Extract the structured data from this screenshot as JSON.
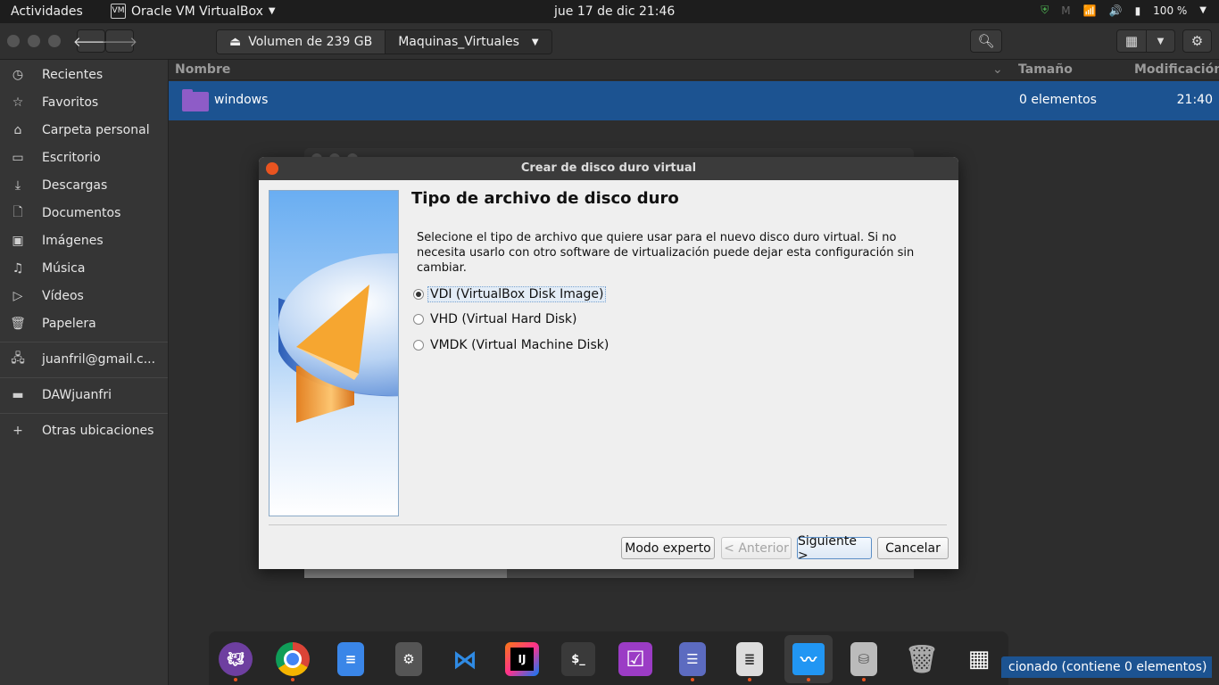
{
  "topbar": {
    "activities": "Actividades",
    "app_name": "Oracle VM VirtualBox",
    "app_menu_arrow": "chevron-down-icon",
    "clock": "jue 17 de dic  21:46",
    "battery": "100 %"
  },
  "files": {
    "pathbar": {
      "volume": "Volumen de 239 GB",
      "folder": "Maquinas_Virtuales"
    },
    "sidebar": {
      "items": [
        {
          "label": "Recientes",
          "icon": "clock-icon"
        },
        {
          "label": "Favoritos",
          "icon": "star-icon"
        },
        {
          "label": "Carpeta personal",
          "icon": "home-icon"
        },
        {
          "label": "Escritorio",
          "icon": "desktop-icon"
        },
        {
          "label": "Descargas",
          "icon": "download-icon"
        },
        {
          "label": "Documentos",
          "icon": "document-icon"
        },
        {
          "label": "Imágenes",
          "icon": "image-icon"
        },
        {
          "label": "Música",
          "icon": "music-icon"
        },
        {
          "label": "Vídeos",
          "icon": "video-icon"
        },
        {
          "label": "Papelera",
          "icon": "trash-icon"
        }
      ],
      "account": "juanfril@gmail.c...",
      "drive": "DAWjuanfri",
      "other": "Otras ubicaciones"
    },
    "columns": {
      "name": "Nombre",
      "size": "Tamaño",
      "modified": "Modificación"
    },
    "rows": [
      {
        "name": "windows",
        "size": "0 elementos",
        "modified": "21:40"
      }
    ],
    "status": "cionado  (contiene 0 elementos)"
  },
  "dialog": {
    "title": "Crear de disco duro virtual",
    "heading": "Tipo de archivo de disco duro",
    "description": "Selecione el tipo de archivo que quiere usar para el nuevo disco duro virtual. Si no necesita usarlo con otro software de virtualización puede dejar esta configuración sin cambiar.",
    "options": [
      {
        "label": "VDI (VirtualBox Disk Image)",
        "selected": true
      },
      {
        "label": "VHD (Virtual Hard Disk)",
        "selected": false
      },
      {
        "label": "VMDK (Virtual Machine Disk)",
        "selected": false
      }
    ],
    "buttons": {
      "expert": "Modo experto",
      "back": "< Anterior",
      "next": "Siguiente >",
      "cancel": "Cancelar"
    }
  },
  "dock": {
    "apps": [
      "github-desktop-icon",
      "chrome-icon",
      "text-editor-icon",
      "settings-icon",
      "vscode-icon",
      "intellij-icon",
      "terminal-icon",
      "tasks-icon",
      "file-cabinet-icon",
      "document-viewer-icon",
      "system-monitor-icon",
      "disk-icon",
      "trash-icon",
      "app-grid-icon"
    ],
    "terminal_label": "$_",
    "intellij_label": "IJ"
  }
}
